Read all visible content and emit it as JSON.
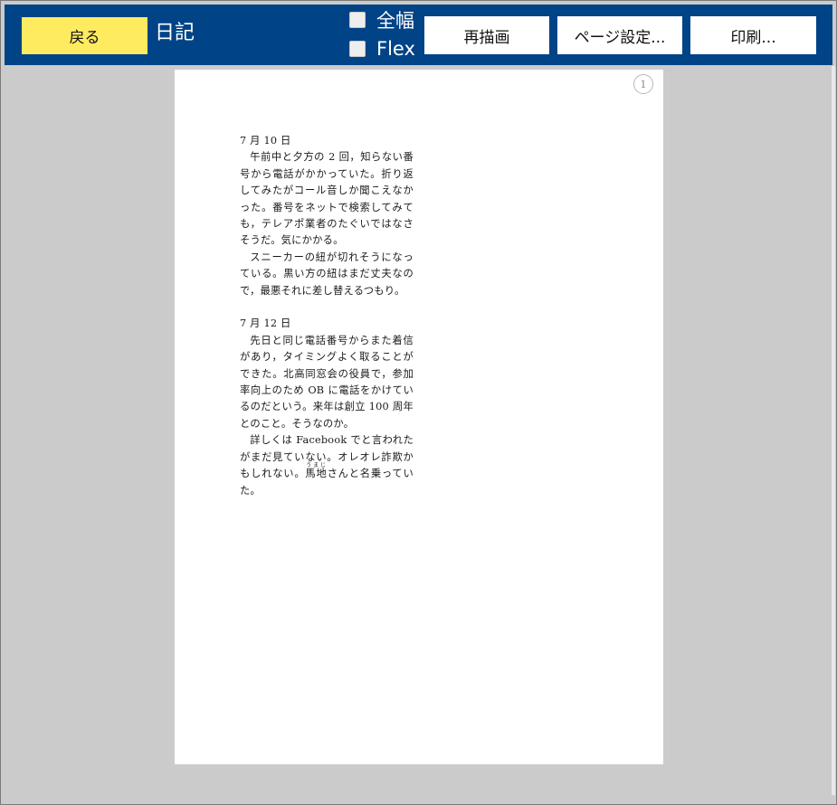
{
  "toolbar": {
    "back_label": "戻る",
    "title": "日記",
    "fullwidth_label": "全幅",
    "flex_label": "Flex",
    "redraw_label": "再描画",
    "page_setup_label": "ページ設定...",
    "print_label": "印刷..."
  },
  "page": {
    "number": "1",
    "entries": [
      {
        "date": "7 月 10 日",
        "paragraphs": [
          "午前中と夕方の 2 回，知らない番号から電話がかかっていた。折り返してみたがコール音しか聞こえなかった。番号をネットで検索してみても，テレアポ業者のたぐいではなさそうだ。気にかかる。",
          "スニーカーの紐が切れそうになっている。黒い方の紐はまだ丈夫なので，最悪それに差し替えるつもり。"
        ]
      },
      {
        "date": "7 月 12 日",
        "paragraphs": [
          "先日と同じ電話番号からまた着信があり，タイミングよく取ることができた。北高同窓会の役員で，参加率向上のため OB に電話をかけているのだという。来年は創立 100 周年とのこと。そうなのか。",
          "詳しくは Facebook でと言われたがまだ見ていない。オレオレ詐欺かもしれない。"
        ],
        "ruby": {
          "base": "馬地",
          "reading": "うまじ"
        },
        "closing": "さんと名乗っていた。"
      }
    ]
  }
}
